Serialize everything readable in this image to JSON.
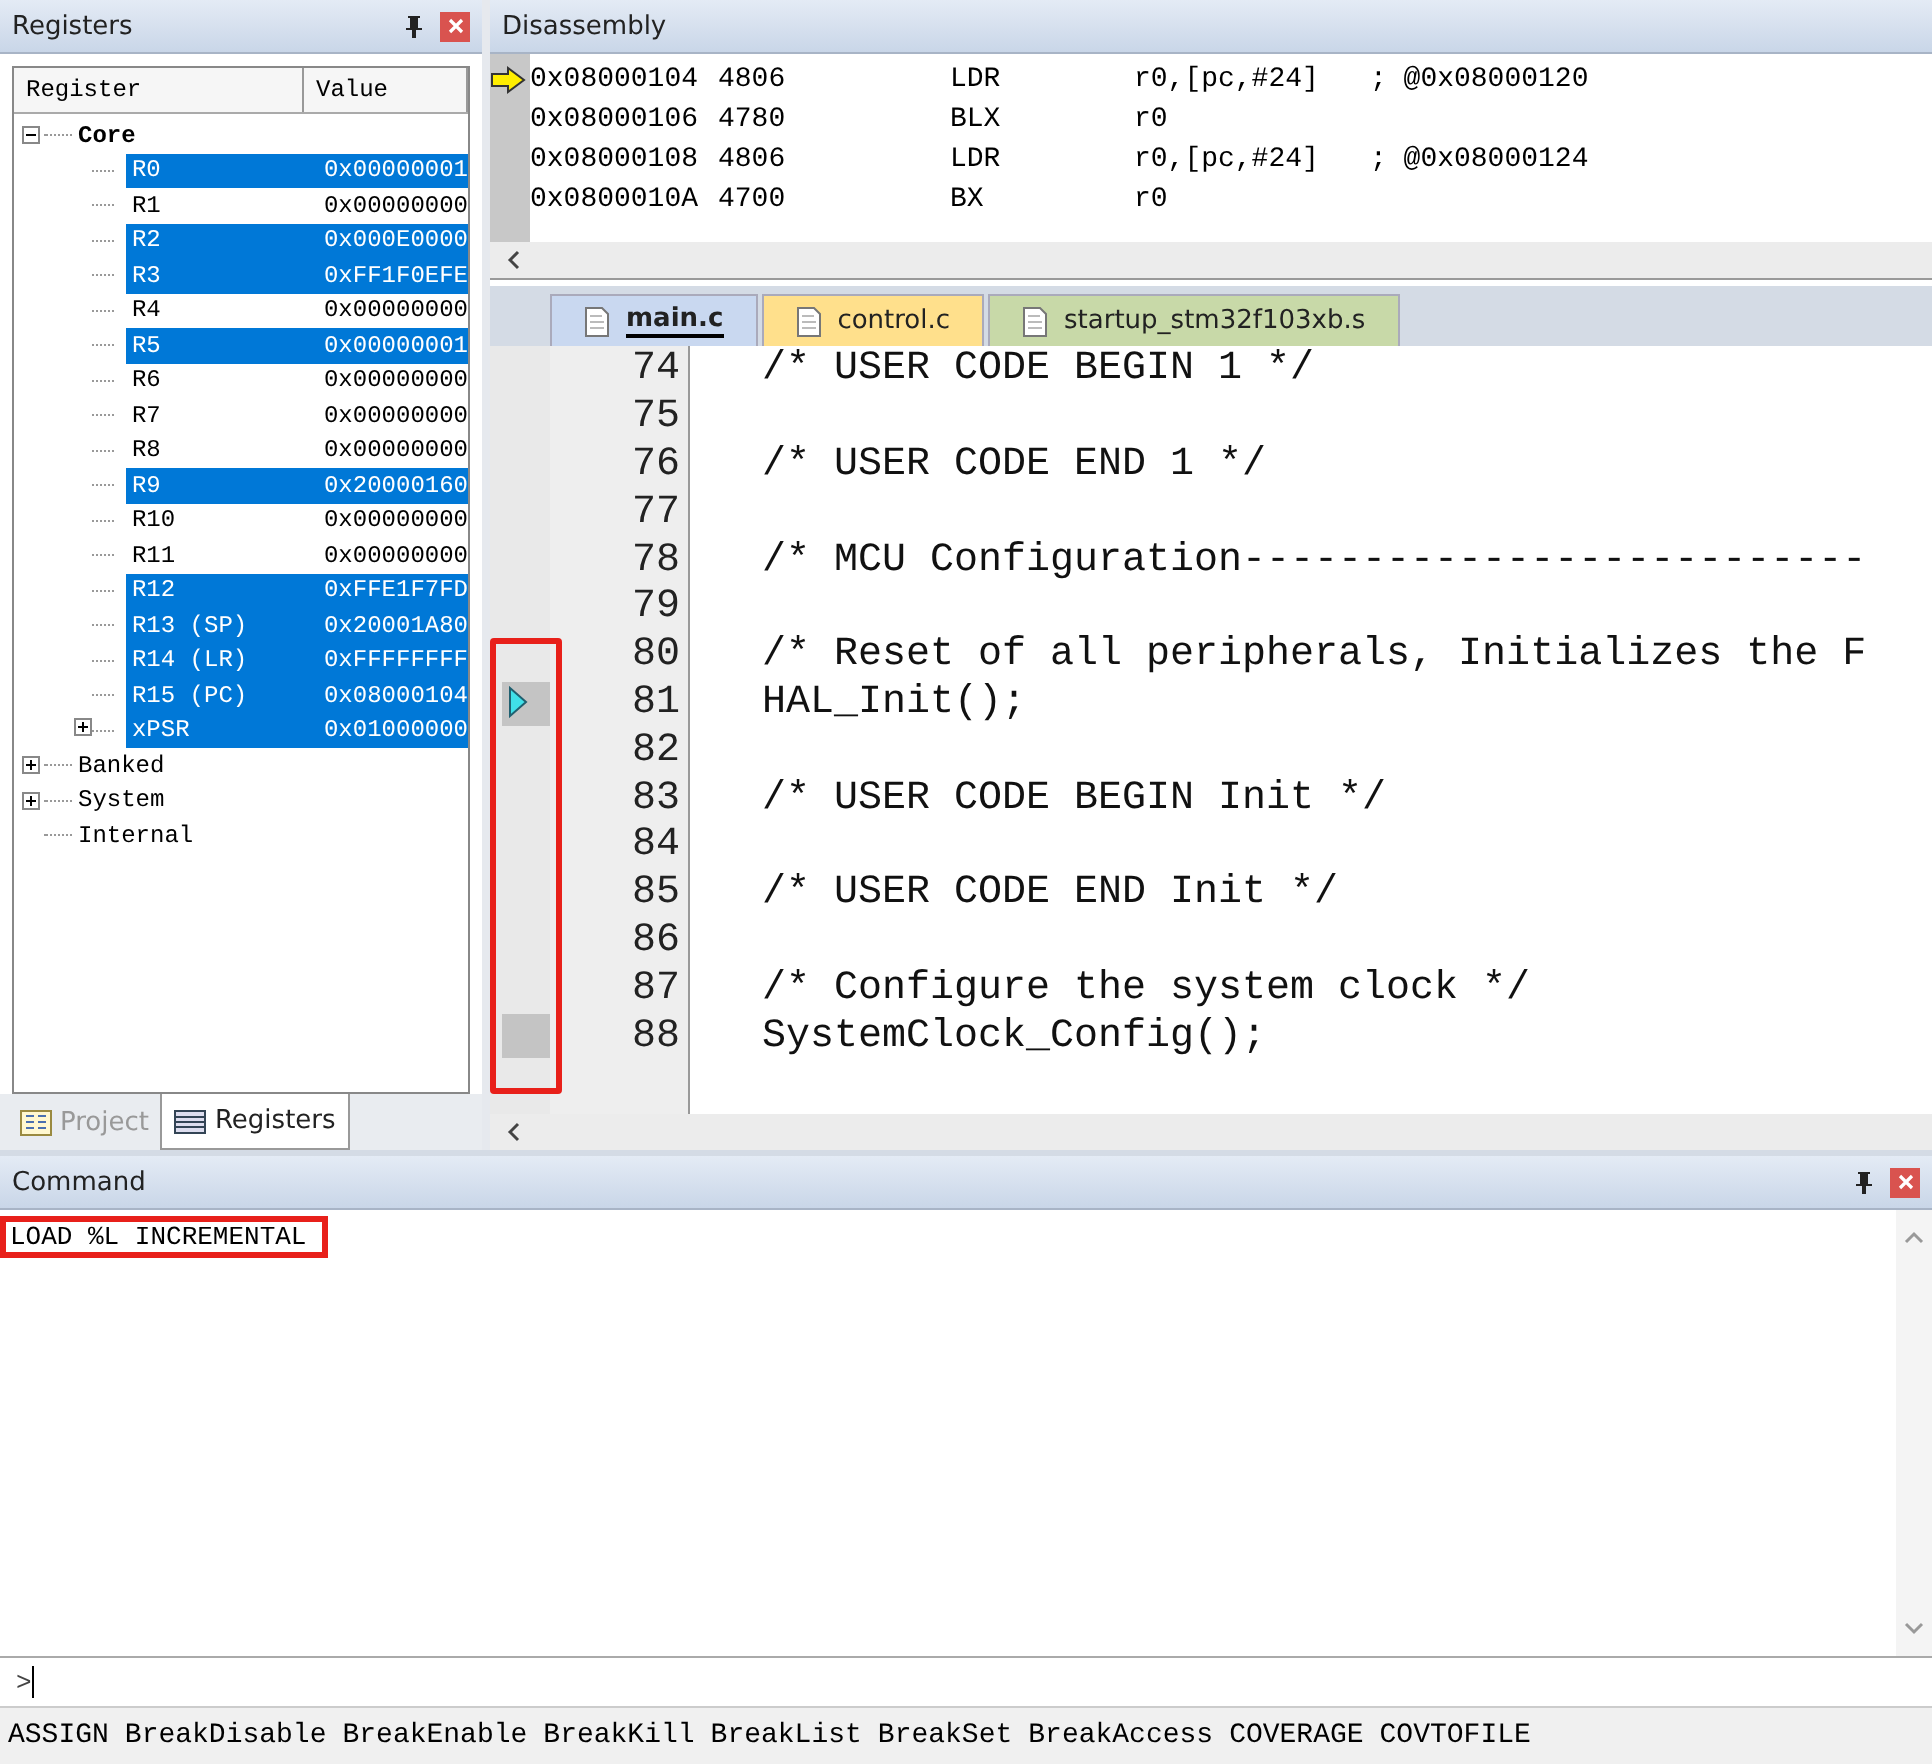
{
  "registers_panel": {
    "title": "Registers",
    "columns": [
      "Register",
      "Value"
    ],
    "tree": [
      {
        "label": "Core",
        "expanded": true,
        "children": [
          {
            "name": "R0",
            "value": "0x00000001",
            "selected": true
          },
          {
            "name": "R1",
            "value": "0x00000000",
            "selected": false
          },
          {
            "name": "R2",
            "value": "0x000E0000",
            "selected": true
          },
          {
            "name": "R3",
            "value": "0xFF1F0EFE",
            "selected": true
          },
          {
            "name": "R4",
            "value": "0x00000000",
            "selected": false
          },
          {
            "name": "R5",
            "value": "0x00000001",
            "selected": true
          },
          {
            "name": "R6",
            "value": "0x00000000",
            "selected": false
          },
          {
            "name": "R7",
            "value": "0x00000000",
            "selected": false
          },
          {
            "name": "R8",
            "value": "0x00000000",
            "selected": false
          },
          {
            "name": "R9",
            "value": "0x20000160",
            "selected": true
          },
          {
            "name": "R10",
            "value": "0x00000000",
            "selected": false
          },
          {
            "name": "R11",
            "value": "0x00000000",
            "selected": false
          },
          {
            "name": "R12",
            "value": "0xFFE1F7FD",
            "selected": true
          },
          {
            "name": "R13 (SP)",
            "value": "0x20001A80",
            "selected": true
          },
          {
            "name": "R14 (LR)",
            "value": "0xFFFFFFFF",
            "selected": true
          },
          {
            "name": "R15 (PC)",
            "value": "0x08000104",
            "selected": true
          },
          {
            "name": "xPSR",
            "value": "0x01000000",
            "selected": true,
            "expanded": false
          }
        ]
      },
      {
        "label": "Banked",
        "expanded": false
      },
      {
        "label": "System",
        "expanded": false
      },
      {
        "label": "Internal"
      }
    ],
    "tabs": [
      {
        "label": "Project",
        "selected": false
      },
      {
        "label": "Registers",
        "selected": true
      }
    ]
  },
  "disassembly": {
    "title": "Disassembly",
    "rows": [
      {
        "address": "0x08000104",
        "opcode": "4806",
        "mnemonic": "LDR",
        "operands": "r0,[pc,#24]",
        "comment": "; @0x08000120",
        "current": true
      },
      {
        "address": "0x08000106",
        "opcode": "4780",
        "mnemonic": "BLX",
        "operands": "r0",
        "current": false
      },
      {
        "address": "0x08000108",
        "opcode": "4806",
        "mnemonic": "LDR",
        "operands": "r0,[pc,#24]",
        "comment": "; @0x08000124",
        "current": false
      },
      {
        "address": "0x0800010A",
        "opcode": "4700",
        "mnemonic": "BX",
        "operands": "r0",
        "current": false
      }
    ]
  },
  "editor": {
    "tabs": [
      {
        "label": "main.c",
        "selected": true,
        "color": "#c9d8f0"
      },
      {
        "label": "control.c",
        "selected": false,
        "color": "#ffe08c"
      },
      {
        "label": "startup_stm32f103xb.s",
        "selected": false,
        "color": "#c8d9a8"
      }
    ],
    "lines": [
      {
        "number": "74",
        "text": "/* USER CODE BEGIN 1 */",
        "kind": "comment",
        "executable": false,
        "current": false
      },
      {
        "number": "75",
        "kind": "blank",
        "executable": false,
        "current": false
      },
      {
        "number": "76",
        "text": "/* USER CODE END 1 */",
        "kind": "comment",
        "executable": false,
        "current": false
      },
      {
        "number": "77",
        "kind": "blank",
        "executable": false,
        "current": false
      },
      {
        "number": "78",
        "text": "/* MCU Configuration--------------------------",
        "kind": "comment",
        "executable": false,
        "current": false
      },
      {
        "number": "79",
        "kind": "blank",
        "executable": false,
        "current": false
      },
      {
        "number": "80",
        "text": "/* Reset of all peripherals, Initializes the F",
        "kind": "comment",
        "executable": false,
        "current": false
      },
      {
        "number": "81",
        "text": "HAL_Init();",
        "kind": "code",
        "executable": true,
        "current": true
      },
      {
        "number": "82",
        "kind": "blank",
        "executable": false,
        "current": false
      },
      {
        "number": "83",
        "text": "/* USER CODE BEGIN Init */",
        "kind": "comment",
        "executable": false,
        "current": false
      },
      {
        "number": "84",
        "kind": "blank",
        "executable": false,
        "current": false
      },
      {
        "number": "85",
        "text": "/* USER CODE END Init */",
        "kind": "comment",
        "executable": false,
        "current": false
      },
      {
        "number": "86",
        "kind": "blank",
        "executable": false,
        "current": false
      },
      {
        "number": "87",
        "text": "/* Configure the system clock */",
        "kind": "comment",
        "executable": false,
        "current": false
      },
      {
        "number": "88",
        "text": "SystemClock_Config();",
        "kind": "code",
        "executable": true,
        "current": false
      }
    ]
  },
  "command": {
    "title": "Command",
    "output": [
      "LOAD %L INCREMENTAL"
    ],
    "prompt": ">",
    "hints": [
      "ASSIGN",
      "BreakDisable",
      "BreakEnable",
      "BreakKill",
      "BreakList",
      "BreakSet",
      "BreakAccess",
      "COVERAGE",
      "COVTOFILE"
    ]
  }
}
